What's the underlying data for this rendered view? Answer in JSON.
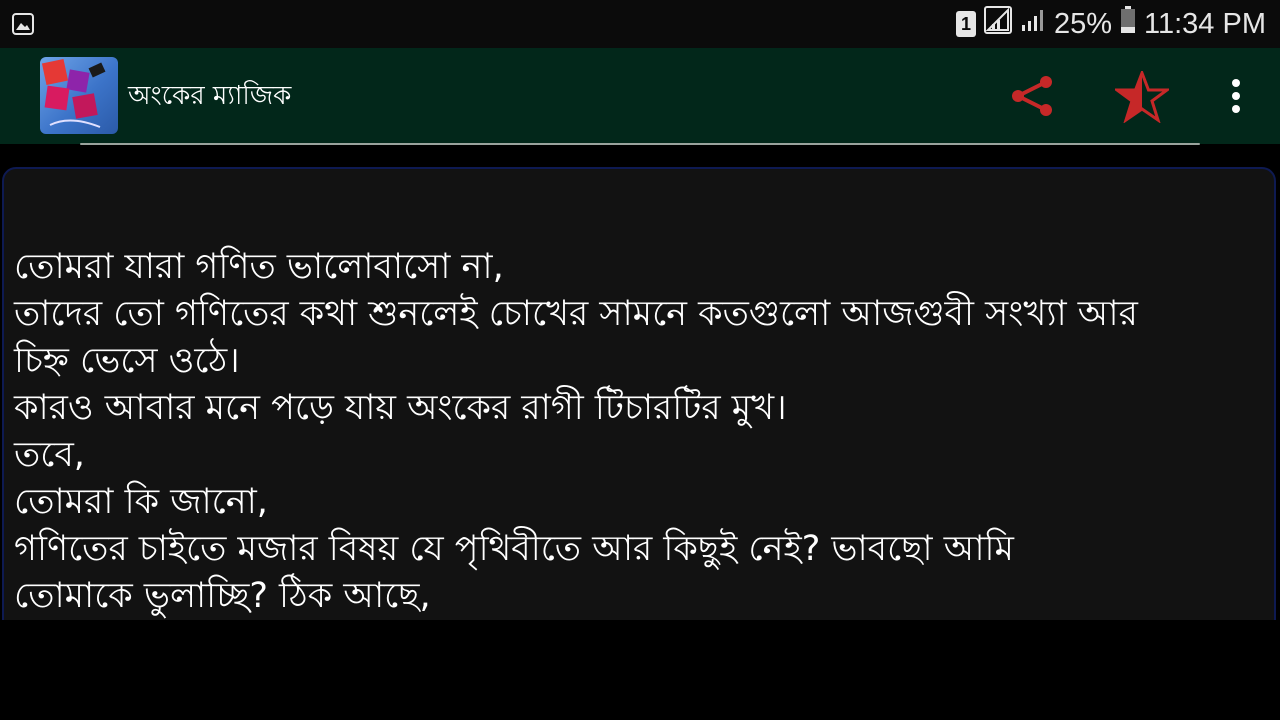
{
  "status_bar": {
    "sim_slot": "1",
    "battery_percent": "25%",
    "time": "11:34 PM",
    "left_icon": "gallery-notification-icon",
    "signal_icon": "cell-signal-icon",
    "battery_icon": "battery-icon",
    "battery_level": 0.25
  },
  "app_bar": {
    "title": "অংকের ম্যাজিক",
    "icon": "app-logo-icon",
    "background": "#02271a",
    "share_icon": "share-icon",
    "favorite_icon": "star-half-icon",
    "menu_icon": "overflow-menu-icon",
    "accent": "#c62828"
  },
  "content": {
    "lines": [
      " তোমরা যারা গণিত ভালোবাসো না,",
      " তাদের তো গণিতের কথা শুনলেই চোখের সামনে কতগুলো আজগুবী সংখ্যা আর",
      "চিহ্ন ভেসে ওঠে।",
      " কারও আবার মনে পড়ে যায় অংকের রাগী টিচারটির মুখ।",
      " তবে,",
      " তোমরা কি জানো,",
      " গণিতের চাইতে মজার বিষয় যে পৃথিবীতে আর কিছুই নেই?  ভাবছো আমি",
      "তোমাকে ভুলাচ্ছি? ঠিক আছে,"
    ]
  }
}
